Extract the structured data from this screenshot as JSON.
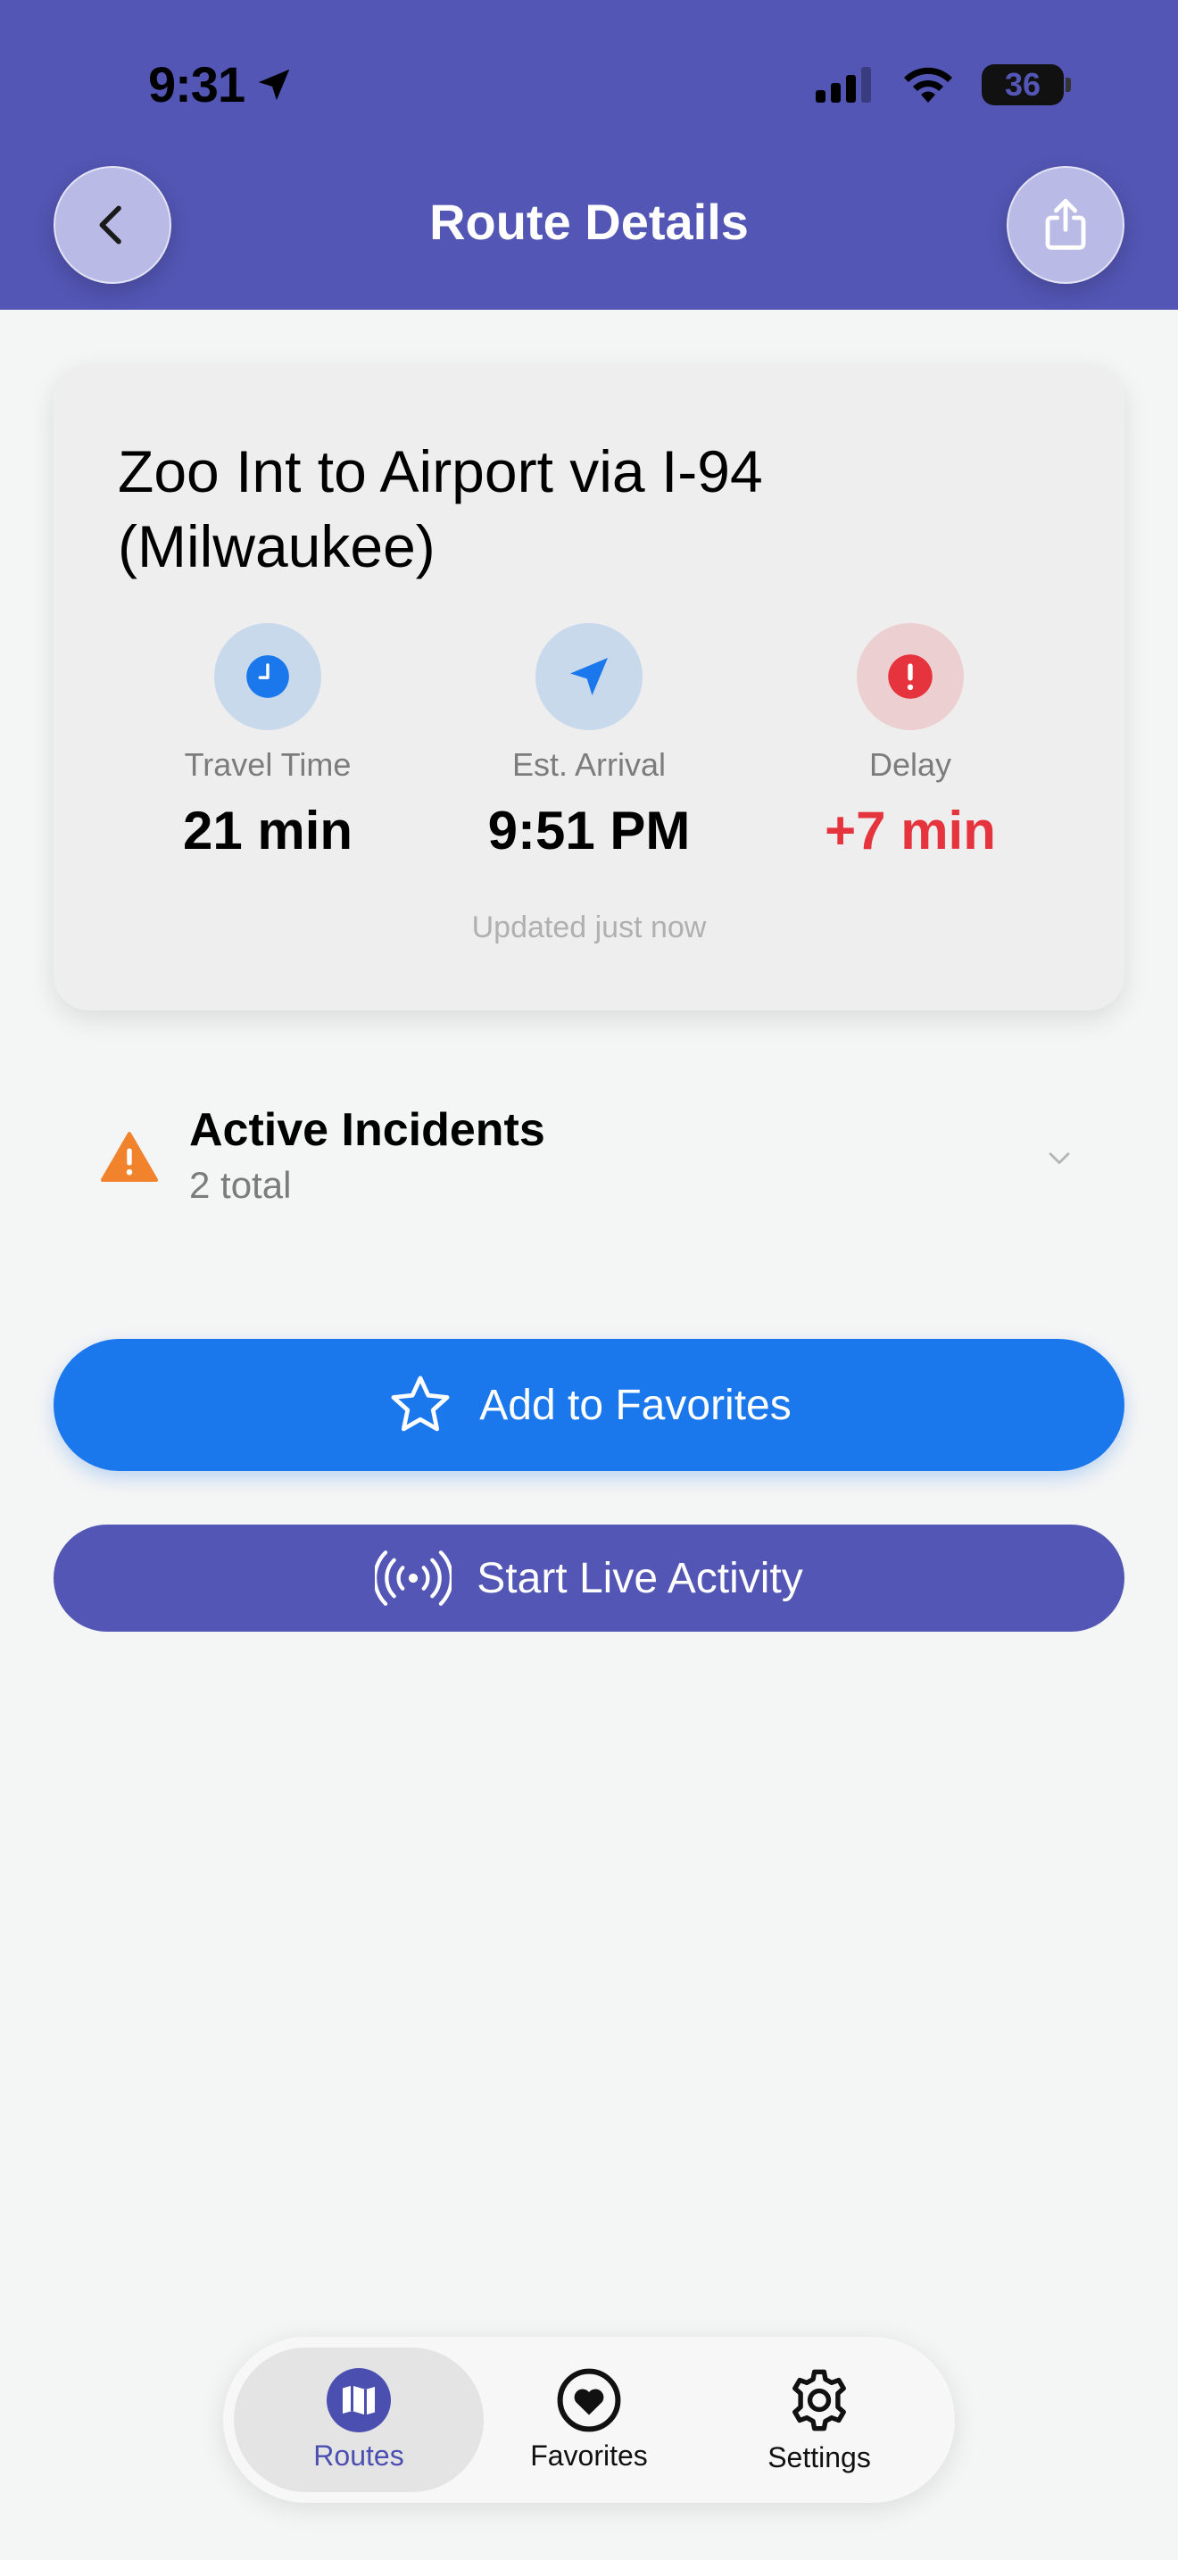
{
  "status_bar": {
    "time": "9:31",
    "battery": "36"
  },
  "header": {
    "title": "Route Details"
  },
  "route": {
    "title": "Zoo Int to Airport via I-94 (Milwaukee)",
    "stats": [
      {
        "label": "Travel Time",
        "value": "21 min",
        "icon": "clock-icon",
        "color": "#1b78ec"
      },
      {
        "label": "Est. Arrival",
        "value": "9:51 PM",
        "icon": "navigation-arrow-icon",
        "color": "#1b78ec"
      },
      {
        "label": "Delay",
        "value": "+7 min",
        "icon": "alert-icon",
        "color": "#e5343d"
      }
    ],
    "updated": "Updated just now"
  },
  "incidents": {
    "title": "Active Incidents",
    "subtitle": "2 total",
    "icon": "warning-triangle-icon",
    "color": "#f0832c"
  },
  "actions": {
    "favorite_label": "Add to Favorites",
    "live_activity_label": "Start Live Activity"
  },
  "tabs": [
    {
      "label": "Routes",
      "icon": "map-icon",
      "active": true
    },
    {
      "label": "Favorites",
      "icon": "heart-icon",
      "active": false
    },
    {
      "label": "Settings",
      "icon": "gear-icon",
      "active": false
    }
  ],
  "colors": {
    "header": "#5356b4",
    "primary": "#1b78ec",
    "danger": "#e5343d",
    "background": "#f4f5f5"
  }
}
